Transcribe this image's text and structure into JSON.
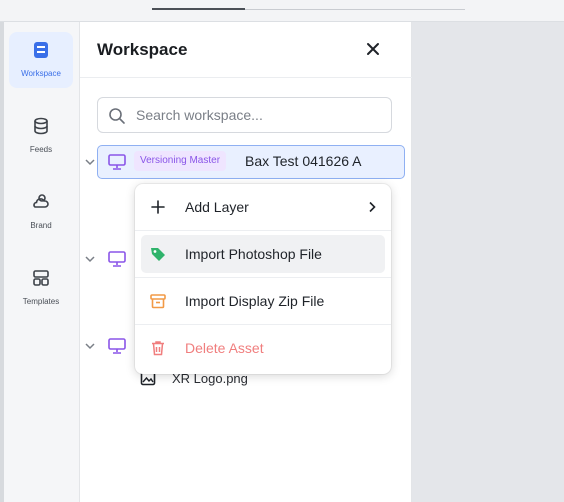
{
  "rail": {
    "items": [
      {
        "label": "Workspace",
        "icon": "workspace-icon",
        "active": true
      },
      {
        "label": "Feeds",
        "icon": "database-icon"
      },
      {
        "label": "Brand",
        "icon": "brand-icon"
      },
      {
        "label": "Templates",
        "icon": "templates-icon"
      }
    ]
  },
  "panel": {
    "title": "Workspace",
    "close_icon": "close-icon"
  },
  "search": {
    "placeholder": "Search workspace...",
    "value": ""
  },
  "tree": {
    "selected_row": {
      "badge": "Versioning Master",
      "name": "Bax Test 041626 A"
    },
    "asset": {
      "name": "XR Logo.png"
    }
  },
  "context_menu": {
    "items": [
      {
        "label": "Add Layer",
        "icon": "plus-icon"
      },
      {
        "label": "Import Photoshop File",
        "icon": "photoshop-tag-icon"
      },
      {
        "label": "Import Display Zip File",
        "icon": "archive-icon"
      },
      {
        "label": "Delete Asset",
        "icon": "trash-icon"
      }
    ]
  },
  "colors": {
    "accent": "#3a6fe8",
    "badge_text": "#8a55e8",
    "danger": "#f07e7e",
    "photoshop_icon": "#2fb36b",
    "zip_icon": "#f29a46"
  }
}
